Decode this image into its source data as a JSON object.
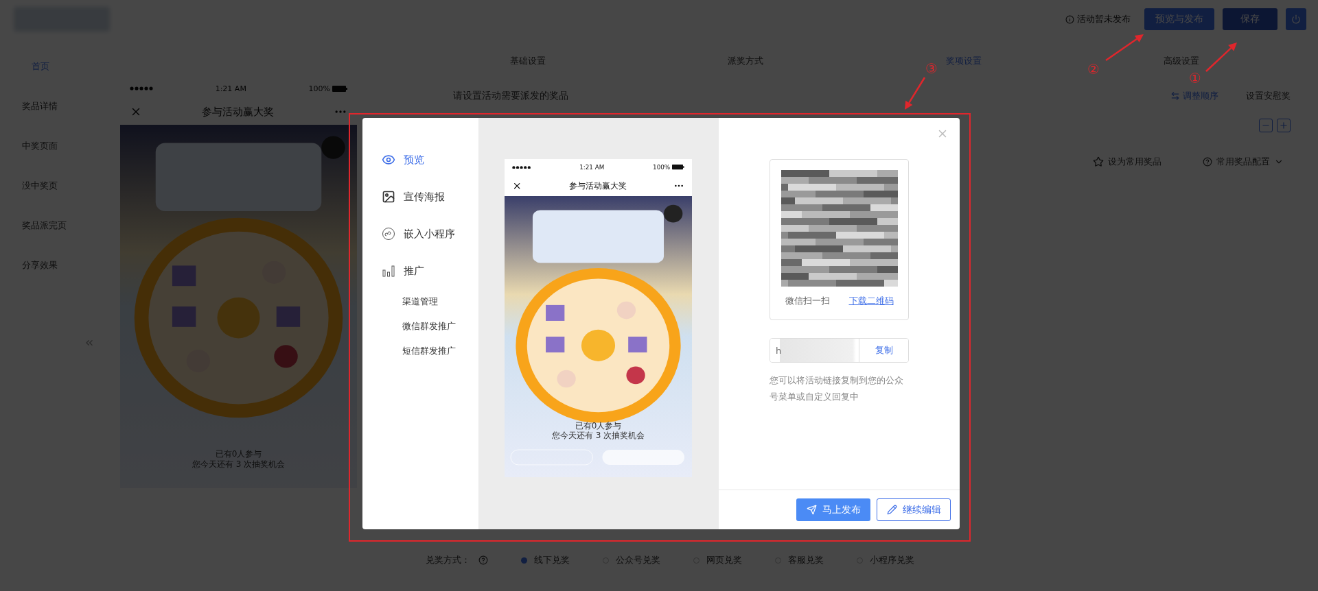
{
  "top_bar": {
    "status": "活动暂未发布",
    "buttons": [
      {
        "label": "预览与发布",
        "kind": "primary"
      },
      {
        "label": "保存",
        "kind": "disabled"
      }
    ]
  },
  "nav": {
    "items": [
      {
        "label": "首页",
        "selected": true
      },
      {
        "label": "奖品详情",
        "selected": false
      },
      {
        "label": "中奖页面",
        "selected": false
      },
      {
        "label": "没中奖页",
        "selected": false
      },
      {
        "label": "奖品派完页",
        "selected": false
      },
      {
        "label": "分享效果",
        "selected": false
      }
    ]
  },
  "background_phone": {
    "time": "1:21 AM",
    "battery": "100%",
    "title": "参与活动赢大奖",
    "participants": "已有0人参与",
    "chances": "您今天还有 3 次抽奖机会"
  },
  "tabs": [
    {
      "label": "基础设置",
      "selected": false
    },
    {
      "label": "派奖方式",
      "selected": false
    },
    {
      "label": "奖项设置",
      "selected": true
    },
    {
      "label": "高级设置",
      "selected": false
    }
  ],
  "prize_panel": {
    "heading": "请设置活动需要派发的奖品",
    "reorder": "调整顺序",
    "consolation": "设置安慰奖",
    "favorite": "设为常用奖品",
    "config": "常用奖品配置"
  },
  "redeem": {
    "label": "兑奖方式：",
    "options": [
      {
        "label": "线下兑奖",
        "selected": true
      },
      {
        "label": "公众号兑奖",
        "selected": false
      },
      {
        "label": "网页兑奖",
        "selected": false
      },
      {
        "label": "客服兑奖",
        "selected": false
      },
      {
        "label": "小程序兑奖",
        "selected": false
      }
    ]
  },
  "modal": {
    "menu": [
      {
        "label": "预览",
        "selected": true
      },
      {
        "label": "宣传海报",
        "selected": false
      },
      {
        "label": "嵌入小程序",
        "selected": false
      },
      {
        "label": "推广",
        "selected": false,
        "children": [
          {
            "label": "渠道管理",
            "selected": false
          },
          {
            "label": "微信群发推广",
            "selected": false
          },
          {
            "label": "短信群发推广",
            "selected": false
          }
        ]
      }
    ],
    "phone": {
      "time": "1:21 AM",
      "battery": "100%",
      "title": "参与活动赢大奖",
      "participants": "已有0人参与",
      "chances": "您今天还有 3 次抽奖机会"
    },
    "qr": {
      "scan_hint": "微信扫一扫",
      "download": "下载二维码"
    },
    "link": {
      "value": "h",
      "copy": "复制"
    },
    "hint": "您可以将活动链接复制到您的公众号菜单或自定义回复中",
    "buttons": [
      {
        "label": "马上发布",
        "kind": "primary"
      },
      {
        "label": "继续编辑",
        "kind": "outline"
      }
    ]
  },
  "annotations": [
    {
      "label": "①"
    },
    {
      "label": "②"
    },
    {
      "label": "③"
    }
  ]
}
